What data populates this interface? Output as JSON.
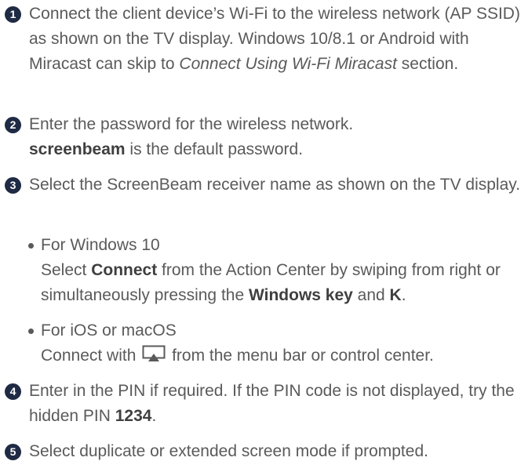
{
  "steps": [
    {
      "num": "1",
      "text_a": "Connect the client device’s Wi-Fi to the wireless network (AP SSID) as shown on the TV display. Windows 10/8.1 or Android with Miracast can skip to ",
      "italic": "Connect Using Wi-Fi Miracast",
      "text_b": " section."
    },
    {
      "num": "2",
      "line1": "Enter the password for the wireless network.",
      "bold": "screenbeam",
      "rest": " is the default password."
    },
    {
      "num": "3",
      "text": "Select the ScreenBeam receiver name as shown on the TV display."
    },
    {
      "num": "4",
      "text_a": "Enter in the PIN if required. If the PIN code is not displayed, try the hidden PIN ",
      "bold": "1234",
      "text_b": "."
    },
    {
      "num": "5",
      "text": "Select duplicate or extended screen mode if prompted."
    }
  ],
  "bullets": [
    {
      "title": "For Windows 10",
      "t1": "Select ",
      "b1": "Connect",
      "t2": " from the Action Center by swiping from right or simultaneously pressing the ",
      "b2": "Windows key",
      "t3": " and ",
      "b3": "K",
      "t4": "."
    },
    {
      "title": "For iOS or macOS",
      "t1": "Connect with ",
      "icon": "screen-mirroring-icon",
      "t2": " from the menu bar or control center."
    }
  ],
  "colors": {
    "text": "#5a5a5a",
    "badge": "#1f2a44",
    "bold": "#3f3f3f"
  }
}
